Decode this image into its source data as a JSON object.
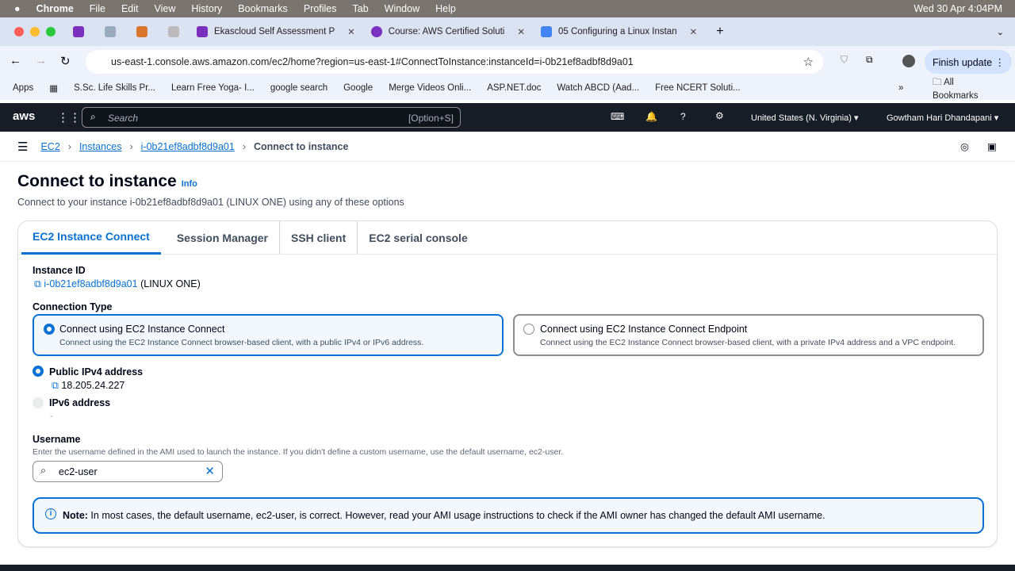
{
  "menubar": {
    "app": "Chrome",
    "items": [
      "File",
      "Edit",
      "View",
      "History",
      "Bookmarks",
      "Profiles",
      "Tab",
      "Window",
      "Help"
    ],
    "clock": "Wed 30 Apr  4:04PM"
  },
  "tabs": [
    {
      "title": "Ekascloud Self Assessment P"
    },
    {
      "title": "Course: AWS Certified Soluti"
    },
    {
      "title": "05 Configuring a Linux Instan"
    }
  ],
  "url": "us-east-1.console.aws.amazon.com/ec2/home?region=us-east-1#ConnectToInstance:instanceId=i-0b21ef8adbf8d9a01",
  "finish_update": "Finish update",
  "bookmarks": [
    "Apps",
    "S.Sc. Life Skills Pr...",
    "Learn Free Yoga- I...",
    "google search",
    "Google",
    "Merge Videos Onli...",
    "ASP.NET.doc",
    "Watch ABCD (Aad...",
    "Free NCERT Soluti..."
  ],
  "all_bookmarks": "All Bookmarks",
  "aws": {
    "search_placeholder": "Search",
    "shortcut": "[Option+S]",
    "region": "United States (N. Virginia) ▾",
    "user": "Gowtham Hari Dhandapani ▾"
  },
  "breadcrumb": [
    "EC2",
    "Instances",
    "i-0b21ef8adbf8d9a01",
    "Connect to instance"
  ],
  "page": {
    "title": "Connect to instance",
    "info": "Info",
    "subtitle": "Connect to your instance i-0b21ef8adbf8d9a01 (LINUX ONE) using any of these options"
  },
  "connect_tabs": [
    "EC2 Instance Connect",
    "Session Manager",
    "SSH client",
    "EC2 serial console"
  ],
  "instance": {
    "label": "Instance ID",
    "id": "i-0b21ef8adbf8d9a01",
    "name": "(LINUX ONE)"
  },
  "connection_type": {
    "label": "Connection Type",
    "options": [
      {
        "title": "Connect using EC2 Instance Connect",
        "desc": "Connect using the EC2 Instance Connect browser-based client, with a public IPv4 or IPv6 address."
      },
      {
        "title": "Connect using EC2 Instance Connect Endpoint",
        "desc": "Connect using the EC2 Instance Connect browser-based client, with a private IPv4 address and a VPC endpoint."
      }
    ]
  },
  "address": {
    "ipv4_label": "Public IPv4 address",
    "ipv4": "18.205.24.227",
    "ipv6_label": "IPv6 address",
    "ipv6": "-"
  },
  "username": {
    "label": "Username",
    "help": "Enter the username defined in the AMI used to launch the instance. If you didn't define a custom username, use the default username, ec2-user.",
    "value": "ec2-user"
  },
  "note": {
    "bold": "Note:",
    "text": " In most cases, the default username, ec2-user, is correct. However, read your AMI usage instructions to check if the AMI owner has changed the default AMI username."
  }
}
